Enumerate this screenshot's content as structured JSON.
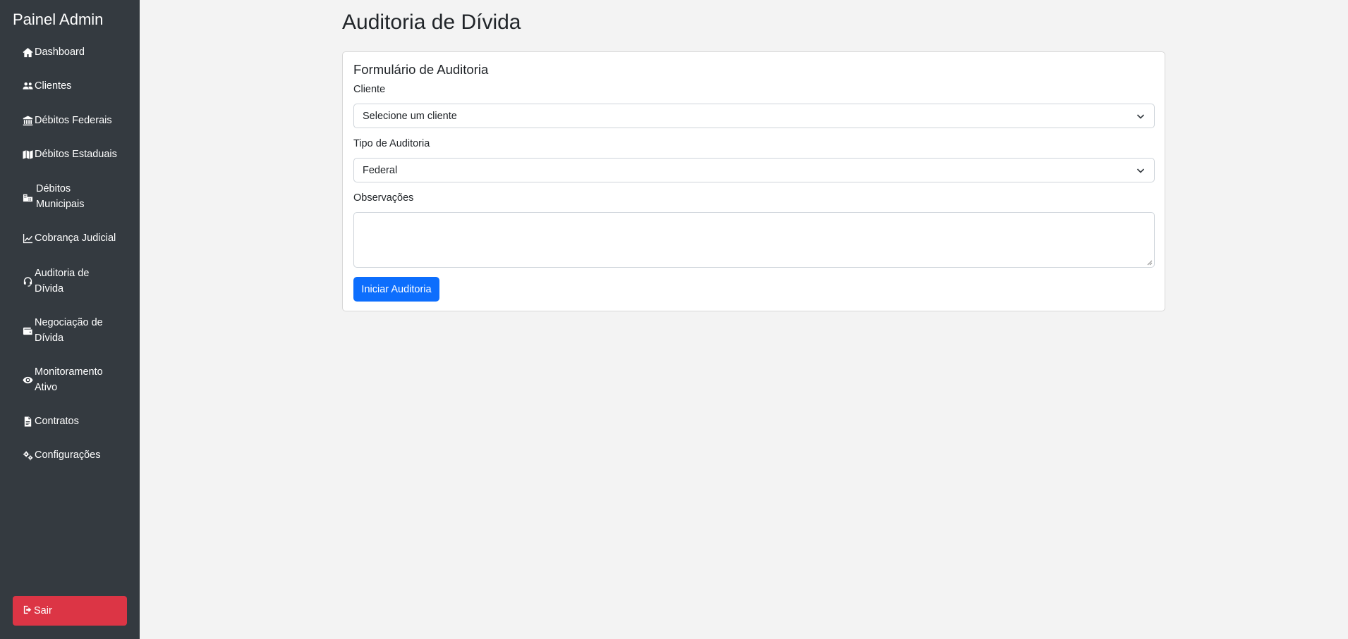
{
  "sidebar": {
    "brand": "Painel Admin",
    "items": [
      {
        "icon": "home-icon",
        "label": "Dashboard"
      },
      {
        "icon": "users-icon",
        "label": "Clientes"
      },
      {
        "icon": "bank-icon",
        "label": "Débitos Federais"
      },
      {
        "icon": "map-icon",
        "label": "Débitos Estaduais"
      },
      {
        "icon": "city-icon",
        "label": "Débitos Municipais"
      },
      {
        "icon": "chart-line-icon",
        "label": "Cobrança Judicial"
      },
      {
        "icon": "headset-icon",
        "label": "Auditoria de Dívida"
      },
      {
        "icon": "wallet-icon",
        "label": "Negociação de Dívida"
      },
      {
        "icon": "eye-icon",
        "label": "Monitoramento Ativo"
      },
      {
        "icon": "contract-icon",
        "label": "Contratos"
      },
      {
        "icon": "gears-icon",
        "label": "Configurações"
      }
    ],
    "logout_label": "Sair"
  },
  "main": {
    "title": "Auditoria de Dívida",
    "card": {
      "title": "Formulário de Auditoria",
      "client_label": "Cliente",
      "client_value": "Selecione um cliente",
      "type_label": "Tipo de Auditoria",
      "type_value": "Federal",
      "notes_label": "Observações",
      "notes_value": "",
      "submit_label": "Iniciar Auditoria"
    }
  },
  "colors": {
    "sidebar_bg": "#343a40",
    "page_bg": "#f3f3f3",
    "primary": "#0d6efd",
    "danger": "#dc3545"
  }
}
